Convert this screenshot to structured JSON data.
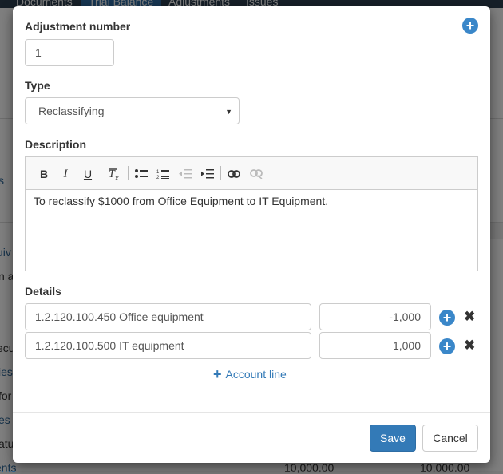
{
  "background": {
    "nav_tabs": [
      "Documents",
      "Trial Balance",
      "Adjustments",
      "Issues"
    ],
    "fragments": [
      "s",
      "uiv",
      "n a",
      "ecu",
      "ies",
      "for",
      "es",
      "atu",
      "ents",
      "10,000.00",
      "10,000.00"
    ]
  },
  "modal": {
    "adjustment_number_label": "Adjustment number",
    "adjustment_number_value": "1",
    "type_label": "Type",
    "type_value": "Reclassifying",
    "description_label": "Description",
    "description_text": "To reclassify $1000 from Office Equipment to IT Equipment.",
    "toolbar": {
      "bold": "B",
      "italic": "I",
      "underline": "U",
      "clear_format": "Tx",
      "bullet_list": "bullet-list-icon",
      "numbered_list": "numbered-list-icon",
      "outdent": "outdent-icon",
      "indent": "indent-icon",
      "link": "link-icon",
      "unlink": "unlink-icon"
    },
    "details_label": "Details",
    "details": [
      {
        "account": "1.2.120.100.450 Office equipment",
        "amount": "-1,000"
      },
      {
        "account": "1.2.120.100.500 IT equipment",
        "amount": "1,000"
      }
    ],
    "add_account_line_label": "Account line",
    "save_label": "Save",
    "cancel_label": "Cancel"
  },
  "colors": {
    "primary": "#337ab7",
    "plus_icon": "#3a87c9",
    "overlay": "rgba(0,0,0,0.5)"
  }
}
